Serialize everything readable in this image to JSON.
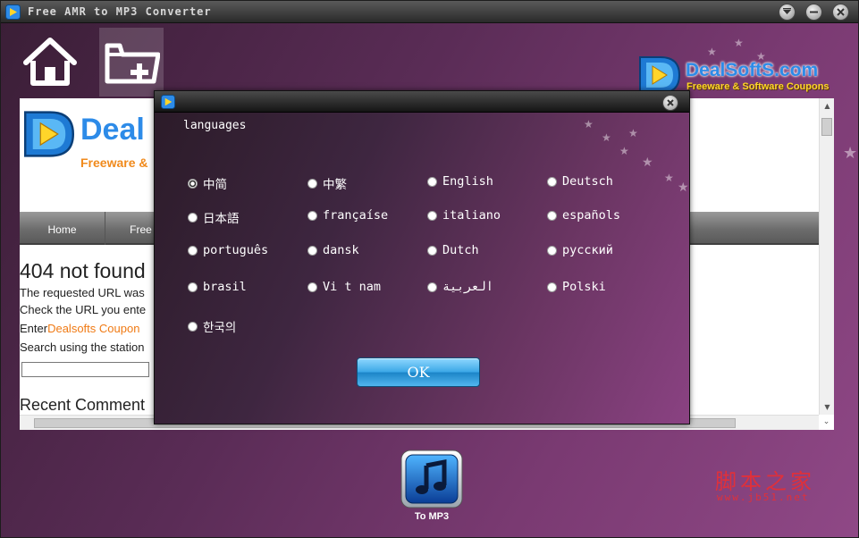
{
  "window": {
    "title": "Free AMR to MP3 Converter"
  },
  "toolbar": {
    "home_icon": "home-icon",
    "add_icon": "folder-add-icon"
  },
  "brand": {
    "name": "DealSoftS.com",
    "tagline": "Freeware & Software Coupons"
  },
  "web": {
    "logo_text": "Deal",
    "logo_tagline": "Freeware &",
    "nav": [
      "Home",
      "Free"
    ],
    "heading": "404 not found",
    "lines": [
      "The requested URL was",
      "Check the URL you ente"
    ],
    "enter_prefix": "Enter",
    "coupon_link": "Dealsofts Coupon",
    "search_line": "Search using the station",
    "recent": "Recent Comment"
  },
  "dialog": {
    "heading": "languages",
    "languages": [
      {
        "label": "中简",
        "selected": true
      },
      {
        "label": "中繁",
        "selected": false
      },
      {
        "label": "English",
        "selected": false
      },
      {
        "label": "Deutsch",
        "selected": false
      },
      {
        "label": "日本語",
        "selected": false
      },
      {
        "label": "françaíse",
        "selected": false
      },
      {
        "label": "italiano",
        "selected": false
      },
      {
        "label": "españols",
        "selected": false
      },
      {
        "label": "português",
        "selected": false
      },
      {
        "label": "dansk",
        "selected": false
      },
      {
        "label": "Dutch",
        "selected": false
      },
      {
        "label": "русский",
        "selected": false
      },
      {
        "label": "brasil",
        "selected": false
      },
      {
        "label": "Vi t nam",
        "selected": false
      },
      {
        "label": "العربية",
        "selected": false
      },
      {
        "label": "Polski",
        "selected": false
      },
      {
        "label": "한국의",
        "selected": false
      }
    ],
    "ok_label": "OK"
  },
  "convert": {
    "label": "To MP3",
    "icon": "music-note-icon"
  },
  "watermark": {
    "text": "脚本之家",
    "url": "www.jb51.net"
  },
  "colors": {
    "accent_blue": "#2d8be8",
    "tagline_yellow": "#ffd52a",
    "coupon_orange": "#f07a14",
    "watermark_red": "#e0303a"
  }
}
